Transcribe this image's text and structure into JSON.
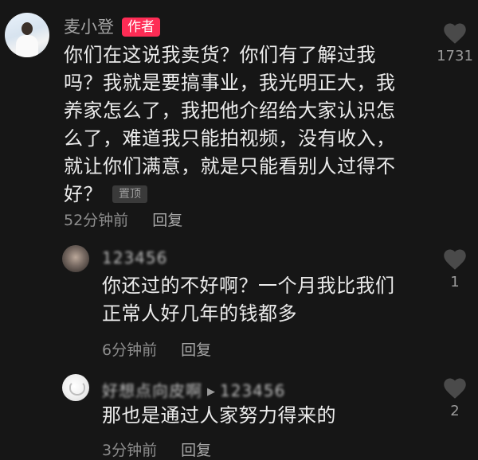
{
  "main_comment": {
    "username": "麦小登",
    "author_badge": "作者",
    "lines": [
      "你们在这说我卖货？你们有了解过我",
      "吗？我就是要搞事业，我光明正大，我",
      "养家怎么了，我把他介绍给大家认识怎",
      "么了，难道我只能拍视频，没有收入，",
      "就让你们满意，就是只能看别人过得不",
      "好？"
    ],
    "pinned_label": "置顶",
    "time": "52分钟前",
    "reply_label": "回复",
    "like_count": "1731"
  },
  "replies": [
    {
      "username": "123456",
      "text": [
        "你还过的不好啊？一个月我比我们",
        "正常人好几年的钱都多"
      ],
      "time": "6分钟前",
      "reply_label": "回复",
      "like_count": "1"
    },
    {
      "username": "好想点向皮啊",
      "reply_to": "123456",
      "text": [
        "那也是通过人家努力得来的"
      ],
      "time": "3分钟前",
      "reply_label": "回复",
      "like_count": "2"
    }
  ],
  "colors": {
    "background": "#161616",
    "author_badge": "#fe2c55",
    "heart": "#4a4a4a"
  }
}
